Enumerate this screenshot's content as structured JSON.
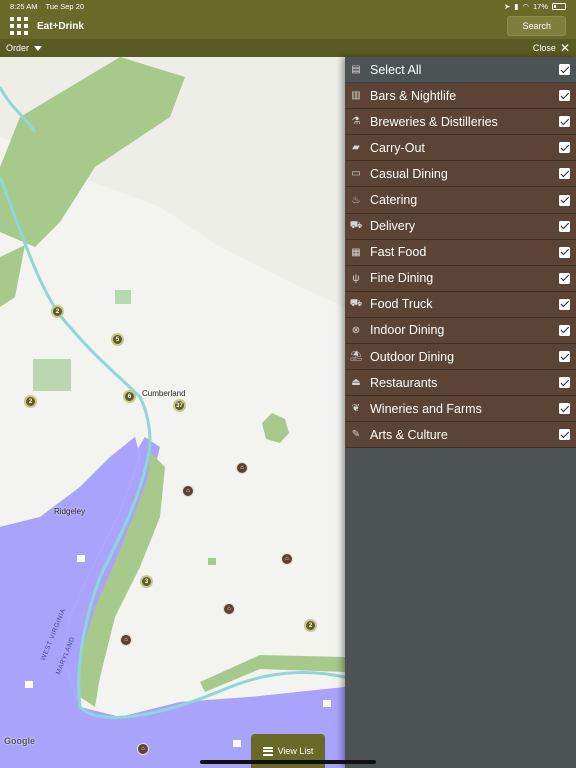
{
  "status_bar": {
    "time": "8:25 AM",
    "date": "Tue Sep 20",
    "battery": "17%"
  },
  "header": {
    "title": "Eat+Drink",
    "search_label": "Search"
  },
  "subbar": {
    "order_label": "Order",
    "close_label": "Close"
  },
  "map": {
    "city_labels": [
      "Cumberland",
      "Ridgeley"
    ],
    "state_labels": [
      "WEST VIRGINIA",
      "MARYLAND"
    ],
    "clusters": [
      "2",
      "5",
      "6",
      "37",
      "2",
      "3",
      "2"
    ],
    "attribution": "Google",
    "view_list_label": "View List"
  },
  "filters": [
    {
      "label": "Select All",
      "icon": "list-icon",
      "checked": true
    },
    {
      "label": "Bars & Nightlife",
      "icon": "city-icon",
      "checked": true
    },
    {
      "label": "Breweries & Distilleries",
      "icon": "distillery-icon",
      "checked": true
    },
    {
      "label": "Carry-Out",
      "icon": "carryout-icon",
      "checked": true
    },
    {
      "label": "Casual Dining",
      "icon": "dining-icon",
      "checked": true
    },
    {
      "label": "Catering",
      "icon": "catering-icon",
      "checked": true
    },
    {
      "label": "Delivery",
      "icon": "truck-icon",
      "checked": true
    },
    {
      "label": "Fast Food",
      "icon": "fastfood-icon",
      "checked": true
    },
    {
      "label": "Fine Dining",
      "icon": "utensils-icon",
      "checked": true
    },
    {
      "label": "Food Truck",
      "icon": "foodtruck-icon",
      "checked": true
    },
    {
      "label": "Indoor Dining",
      "icon": "indoor-icon",
      "checked": true
    },
    {
      "label": "Outdoor Dining",
      "icon": "umbrella-table-icon",
      "checked": true
    },
    {
      "label": "Restaurants",
      "icon": "cloche-icon",
      "checked": true
    },
    {
      "label": "Wineries and Farms",
      "icon": "grapes-icon",
      "checked": true
    },
    {
      "label": "Arts & Culture",
      "icon": "palette-icon",
      "checked": true
    }
  ]
}
